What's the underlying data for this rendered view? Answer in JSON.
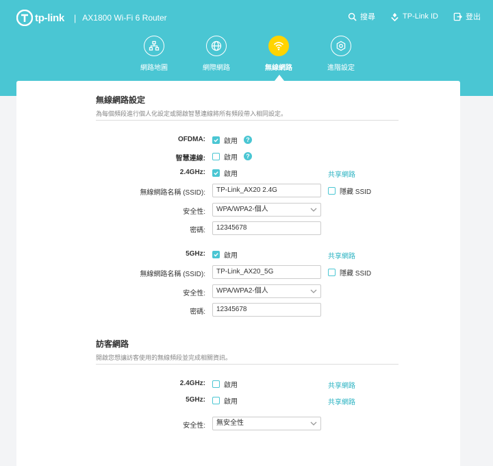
{
  "header": {
    "brand": "tp-link",
    "separator": "|",
    "model": "AX1800 Wi-Fi 6 Router",
    "actions": [
      {
        "label": "搜尋",
        "icon": "search-icon"
      },
      {
        "label": "TP-Link ID",
        "icon": "tplink-id-icon"
      },
      {
        "label": "登出",
        "icon": "logout-icon"
      }
    ]
  },
  "nav": {
    "items": [
      {
        "label": "網路地圖",
        "icon": "network-map-icon"
      },
      {
        "label": "網際網路",
        "icon": "globe-icon"
      },
      {
        "label": "無線網路",
        "icon": "wifi-icon",
        "active": true
      },
      {
        "label": "進階設定",
        "icon": "gear-icon"
      }
    ]
  },
  "wireless": {
    "title": "無線網路設定",
    "desc": "為每個頻段進行個人化設定或開啟智慧連線將所有頻段帶入相同設定。",
    "ofdma": {
      "label": "OFDMA:",
      "option": "啟用",
      "checked": true
    },
    "smart_connect": {
      "label": "智慧連線:",
      "option": "啟用",
      "checked": false
    },
    "band24": {
      "label": "2.4GHz:",
      "option": "啟用",
      "checked": true,
      "share": "共享網路",
      "ssid_label": "無線網路名稱 (SSID):",
      "ssid": "TP-Link_AX20 2.4G",
      "hide_ssid": "隱藏 SSID",
      "security_label": "安全性:",
      "security": "WPA/WPA2-個人",
      "password_label": "密碼:",
      "password": "12345678"
    },
    "band5": {
      "label": "5GHz:",
      "option": "啟用",
      "checked": true,
      "share": "共享網路",
      "ssid_label": "無線網路名稱 (SSID):",
      "ssid": "TP-Link_AX20_5G",
      "hide_ssid": "隱藏 SSID",
      "security_label": "安全性:",
      "security": "WPA/WPA2-個人",
      "password_label": "密碼:",
      "password": "12345678"
    }
  },
  "guest": {
    "title": "訪客網路",
    "desc": "開啟您想讓訪客使用的無線頻段並完成相關資訊。",
    "band24": {
      "label": "2.4GHz:",
      "option": "啟用",
      "checked": false,
      "share": "共享網路"
    },
    "band5": {
      "label": "5GHz:",
      "option": "啟用",
      "checked": false,
      "share": "共享網路"
    },
    "security_label": "安全性:",
    "security": "無安全性"
  },
  "colors": {
    "header": "#4ac6d3",
    "active_nav": "#ffd400",
    "link": "#2bb3c2"
  }
}
